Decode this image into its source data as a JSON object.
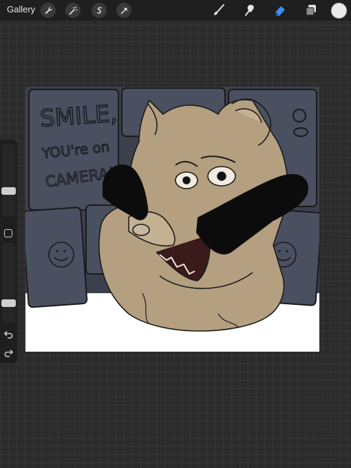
{
  "toolbar": {
    "gallery_label": "Gallery",
    "left_tools": [
      "wrench-icon",
      "magic-wand-icon",
      "selection-icon",
      "transform-arrow-icon"
    ],
    "right_tools": [
      "brush-icon",
      "smudge-icon",
      "eraser-icon",
      "layers-icon"
    ],
    "active_tool": "eraser-icon",
    "active_color": "#e9e9e9"
  },
  "sidebar": {
    "brush_size_level": 0.34,
    "opacity_level": 0.22,
    "undo_icon": "undo-icon",
    "redo_icon": "redo-icon"
  },
  "canvas": {
    "sign_line1": "SMILE,",
    "sign_line2": "YOU're on",
    "sign_line3": "CAMERA!",
    "colors": {
      "monitors": "#4a5060",
      "fur": "#b49f80",
      "hands": "#0c0c0c",
      "background": "#ffffff"
    }
  }
}
